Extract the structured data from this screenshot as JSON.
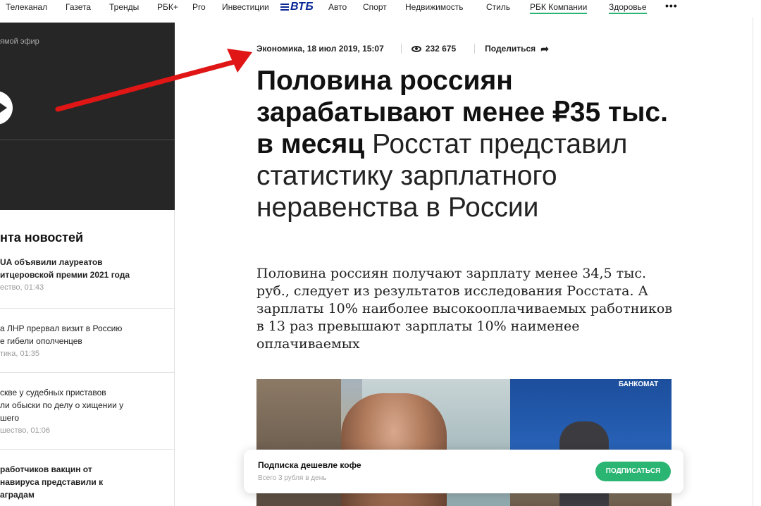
{
  "nav": {
    "items": [
      {
        "label": "Телеканал",
        "underline": false
      },
      {
        "label": "Газета",
        "underline": false
      },
      {
        "label": "Тренды",
        "underline": false
      },
      {
        "label": "РБК+",
        "underline": false
      },
      {
        "label": "Pro",
        "underline": false
      },
      {
        "label": "Инвестиции",
        "underline": false
      },
      {
        "label": "Авто",
        "underline": false
      },
      {
        "label": "Спорт",
        "underline": false
      },
      {
        "label": "Недвижимость",
        "underline": false
      },
      {
        "label": "Стиль",
        "underline": false
      },
      {
        "label": "РБК Компании",
        "underline": true
      },
      {
        "label": "Здоровье",
        "underline": true
      }
    ],
    "vtb_logo": "ВТБ",
    "more_label": "•••",
    "underline_color": "#2ab573"
  },
  "left": {
    "live_label": "ямой эфир",
    "feed_title": "нта новостей",
    "feed": [
      {
        "text": "UA объявили лауреатов\nитцеровской премии 2021 года",
        "meta": "ество, 01:43",
        "bold": true
      },
      {
        "text": "а ЛНР прервал визит в Россию\nе гибели ополченцев",
        "meta": "тика, 01:35",
        "bold": false
      },
      {
        "text": "скве у судебных приставов\nли обыски по делу о хищении у\nшего",
        "meta": "шество, 01:06",
        "bold": false
      },
      {
        "text": "работчиков вакцин от\nнавируса представили к\nаградам",
        "meta": "",
        "bold": true
      }
    ]
  },
  "article": {
    "meta": {
      "rubric_date": "Экономика, 18 июл 2019, 15:07",
      "views": "232 675",
      "share_label": "Поделиться"
    },
    "headline_bold": "Половина россиян зарабатывают менее ₽35 тыс. в месяц",
    "headline_sub": "Росстат представил статистику зарплатного неравенства в России",
    "lead": "Половина россиян получают зарплату менее 34,5 тыс. руб., следует из результатов исследования Росстата. А зарплаты 10% наиболее высокооплачиваемых работников в 13 раз превышают зарплаты 10% наименее оплачиваемых",
    "photo_kiosk_label": "БАНКОМАТ"
  },
  "subscribe": {
    "title": "Подписка дешевле кофе",
    "note": "Всего 3 рубля в день",
    "button": "ПОДПИСАТЬСЯ",
    "button_color": "#2ab573"
  },
  "icons": {
    "eye": "eye-icon",
    "share": "share-arrow-icon",
    "play": "play-icon",
    "more": "more-dots-icon"
  },
  "annotation": {
    "arrow_color": "#e01616"
  }
}
